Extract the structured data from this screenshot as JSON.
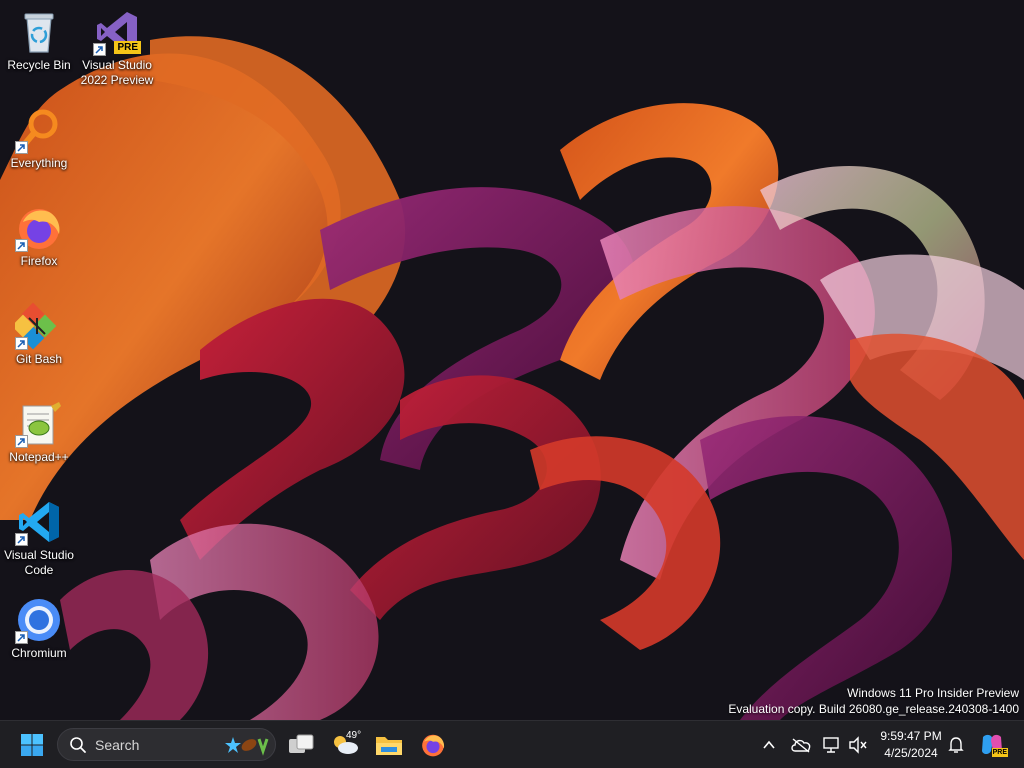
{
  "desktop": {
    "icons": [
      {
        "label": "Recycle Bin"
      },
      {
        "label": "Visual Studio 2022 Preview",
        "badge": "PRE"
      },
      {
        "label": "Everything"
      },
      {
        "label": "Firefox"
      },
      {
        "label": "Git Bash"
      },
      {
        "label": "Notepad++"
      },
      {
        "label": "Visual Studio Code"
      },
      {
        "label": "Chromium"
      }
    ]
  },
  "watermark": {
    "line1": "Windows 11 Pro Insider Preview",
    "line2": "Evaluation copy. Build 26080.ge_release.240308-1400"
  },
  "taskbar": {
    "search_label": "Search",
    "weather_temp": "49°",
    "clock_time": "9:59:47 PM",
    "clock_date": "4/25/2024",
    "copilot_badge": "PRE",
    "accent": "#0078d4"
  }
}
